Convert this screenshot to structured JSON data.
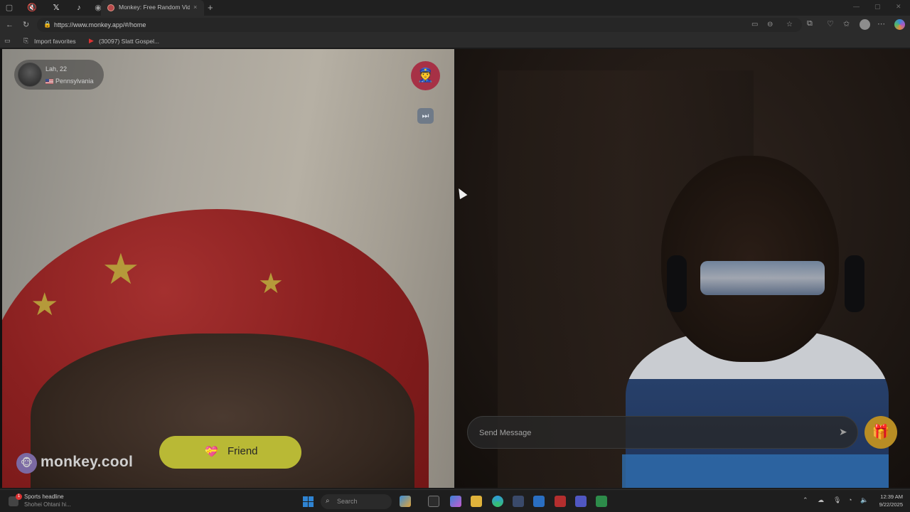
{
  "browser": {
    "tabs": [
      {
        "label": "",
        "icon": "sidebar-icon"
      },
      {
        "label": "",
        "icon": "muted-tab-icon"
      },
      {
        "label": "",
        "icon": "x-logo-icon"
      },
      {
        "label": "",
        "icon": "tiktok-icon"
      },
      {
        "label": "",
        "icon": "monkey-icon"
      }
    ],
    "active_tab": {
      "title": "Monkey: Free Random Video",
      "close": "×"
    },
    "new_tab": "+",
    "url": "https://www.monkey.app/#/home",
    "favorites": [
      {
        "label": "Import favorites"
      },
      {
        "label": "(30097) Slatt Gospel..."
      }
    ]
  },
  "call": {
    "partner": {
      "name_age": "Lah, 22",
      "location": "Pennsylvania"
    },
    "brand": "monkey.cool",
    "friend_button": "Friend",
    "message": {
      "placeholder": "Send Message"
    }
  },
  "taskbar": {
    "news_title": "Sports headline",
    "news_sub": "Shohei Ohtani hi...",
    "news_badge": "1",
    "search_placeholder": "Search",
    "time": "12:39 AM",
    "date": "9/22/2025"
  },
  "colors": {
    "friend_button": "#b9b935",
    "police_button": "#a73146",
    "gift_button": "#b88d24",
    "brand_logo": "#7b69a3"
  }
}
